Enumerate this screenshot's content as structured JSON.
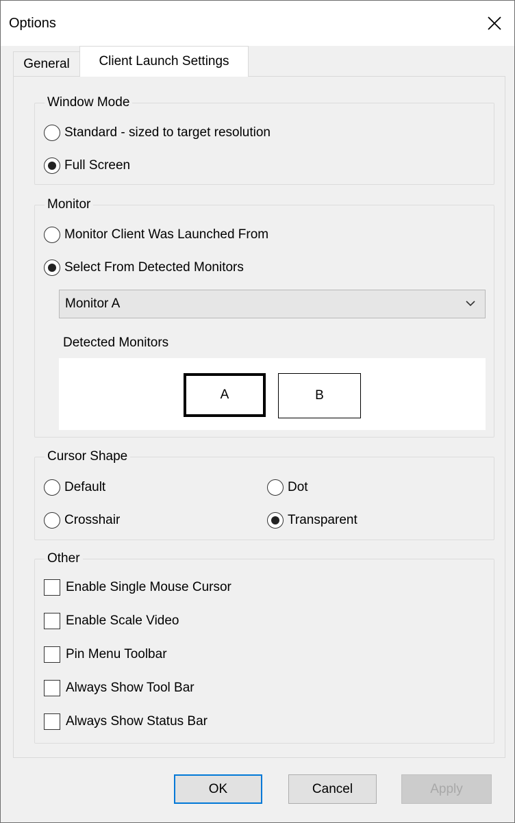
{
  "window": {
    "title": "Options",
    "close_icon": "close-icon"
  },
  "tabs": [
    {
      "label": "General",
      "active": false
    },
    {
      "label": "Client Launch Settings",
      "active": true
    }
  ],
  "window_mode": {
    "label": "Window Mode",
    "options": [
      {
        "label": "Standard - sized to target resolution",
        "checked": false
      },
      {
        "label": "Full Screen",
        "checked": true
      }
    ]
  },
  "monitor": {
    "label": "Monitor",
    "options": [
      {
        "label": "Monitor Client Was Launched From",
        "checked": false
      },
      {
        "label": "Select From Detected Monitors",
        "checked": true
      }
    ],
    "selected_monitor": "Monitor A",
    "detected_label": "Detected Monitors",
    "detected": [
      {
        "label": "A",
        "selected": true
      },
      {
        "label": "B",
        "selected": false
      }
    ]
  },
  "cursor_shape": {
    "label": "Cursor Shape",
    "options": [
      {
        "label": "Default",
        "checked": false
      },
      {
        "label": "Dot",
        "checked": false
      },
      {
        "label": "Crosshair",
        "checked": false
      },
      {
        "label": "Transparent",
        "checked": true
      }
    ]
  },
  "other": {
    "label": "Other",
    "options": [
      {
        "label": "Enable Single Mouse Cursor",
        "checked": false
      },
      {
        "label": "Enable Scale Video",
        "checked": false
      },
      {
        "label": "Pin Menu Toolbar",
        "checked": false
      },
      {
        "label": "Always Show Tool Bar",
        "checked": false
      },
      {
        "label": "Always Show Status Bar",
        "checked": false
      }
    ]
  },
  "buttons": {
    "ok": "OK",
    "cancel": "Cancel",
    "apply": "Apply",
    "apply_enabled": false
  }
}
